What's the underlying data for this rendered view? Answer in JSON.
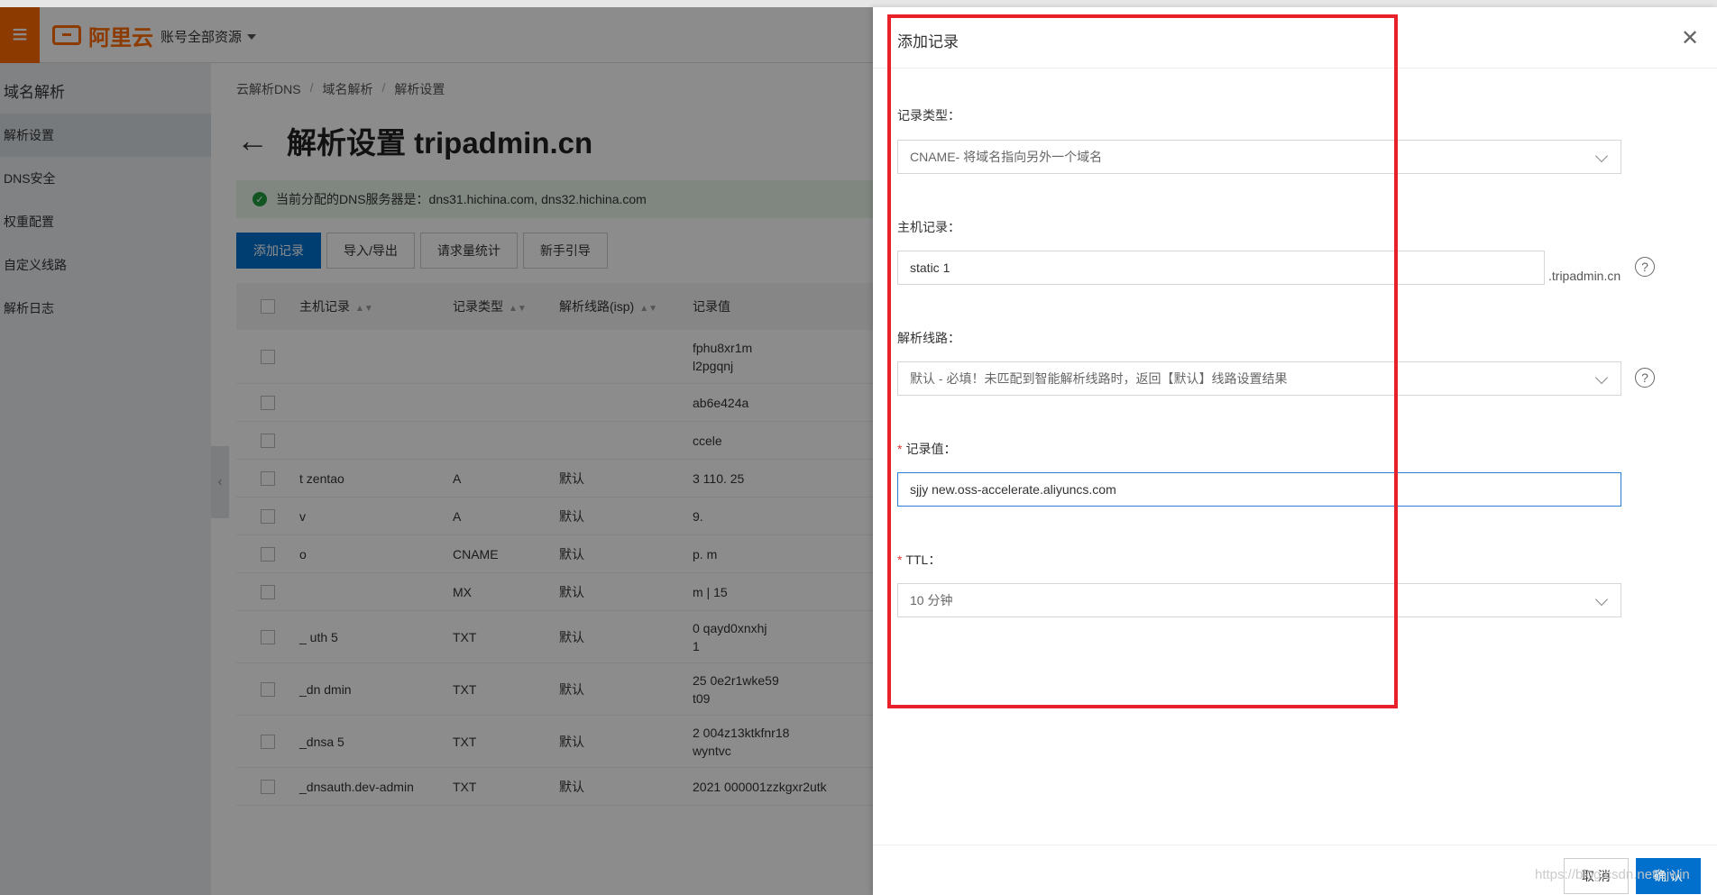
{
  "topbar": {
    "logo_text": "阿里云",
    "account_label": "账号全部资源"
  },
  "sidebar": {
    "title": "域名解析",
    "items": [
      {
        "label": "解析设置",
        "active": true
      },
      {
        "label": "DNS安全"
      },
      {
        "label": "权重配置"
      },
      {
        "label": "自定义线路"
      },
      {
        "label": "解析日志"
      }
    ]
  },
  "breadcrumb": [
    "云解析DNS",
    "域名解析",
    "解析设置"
  ],
  "page_title": "解析设置 tripadmin.cn",
  "dns_notice": "当前分配的DNS服务器是：dns31.hichina.com, dns32.hichina.com",
  "toolbar": {
    "add": "添加记录",
    "import_export": "导入/导出",
    "stats": "请求量统计",
    "guide": "新手引导"
  },
  "table": {
    "headers": [
      "主机记录",
      "记录类型",
      "解析线路(isp)",
      "记录值"
    ],
    "rows": [
      {
        "host": "",
        "type": "",
        "line": "",
        "value": "fphu8xr1m",
        "value2": "l2pgqnj"
      },
      {
        "host": "",
        "type": "",
        "line": "",
        "value": "ab6e424a",
        "value2": ""
      },
      {
        "host": "",
        "type": "",
        "line": "",
        "value": "ccele",
        "value2": ""
      },
      {
        "host": "t zentao",
        "type": "A",
        "line": "默认",
        "value": "3 110. 25",
        "value2": ""
      },
      {
        "host": "v",
        "type": "A",
        "line": "默认",
        "value": "9.",
        "value2": ""
      },
      {
        "host": "o",
        "type": "CNAME",
        "line": "默认",
        "value": "p. m",
        "value2": ""
      },
      {
        "host": "",
        "type": "MX",
        "line": "默认",
        "value": "m | 15",
        "value2": ""
      },
      {
        "host": "_ uth 5",
        "type": "TXT",
        "line": "默认",
        "value": "0 qayd0xnxhj",
        "value2": "1"
      },
      {
        "host": "_dn dmin",
        "type": "TXT",
        "line": "默认",
        "value": "25 0e2r1wke59",
        "value2": "t09"
      },
      {
        "host": "_dnsa 5",
        "type": "TXT",
        "line": "默认",
        "value": "2 004z13ktkfnr18",
        "value2": "wyntvc"
      },
      {
        "host": "_dnsauth.dev-admin",
        "type": "TXT",
        "line": "默认",
        "value": "2021 000001zzkgxr2utk",
        "value2": ""
      }
    ]
  },
  "drawer": {
    "title": "添加记录",
    "record_type_label": "记录类型：",
    "record_type_value": "CNAME- 将域名指向另外一个域名",
    "host_label": "主机记录：",
    "host_value": "static 1",
    "host_suffix": ".tripadmin.cn",
    "line_label": "解析线路：",
    "line_value": "默认 - 必填！未匹配到智能解析线路时，返回【默认】线路设置结果",
    "value_label": "记录值：",
    "value_value": "sjjy new.oss-accelerate.aliyuncs.com",
    "ttl_label": "TTL：",
    "ttl_value": "10 分钟",
    "cancel": "取 消",
    "confirm": "确 认"
  },
  "watermark": "https://blog.csdn.net/sjwin",
  "colors": {
    "brand": "#ff6a00",
    "primary": "#0070cc",
    "highlight": "#e8202a",
    "success": "#1e9b3e"
  }
}
